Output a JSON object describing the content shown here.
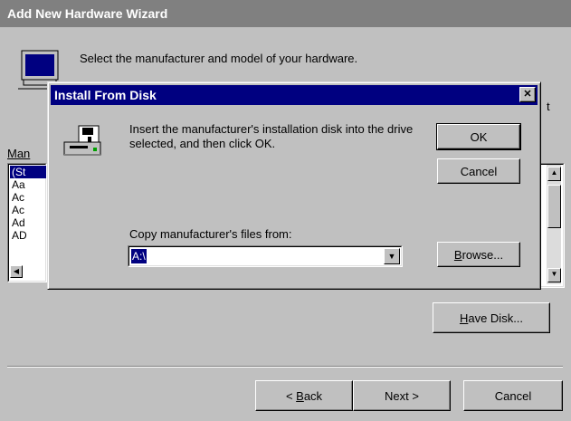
{
  "wizard": {
    "title": "Add New Hardware Wizard",
    "instruction": "Select the manufacturer and model of your hardware.",
    "right_fragment": "t",
    "manufacturers_label_prefix": "Man",
    "manufacturers": [
      "(St",
      "Aa",
      "Ac",
      "Ac",
      "Ad",
      "AD"
    ],
    "have_disk_prefix": "",
    "have_disk_hotkey": "H",
    "have_disk_rest": "ave Disk...",
    "back_prefix": "< ",
    "back_hotkey": "B",
    "back_rest": "ack",
    "next_label": "Next >",
    "cancel_label": "Cancel"
  },
  "dialog": {
    "title": "Install From Disk",
    "close_glyph": "✕",
    "message": "Insert the manufacturer's installation disk into the drive selected, and then click OK.",
    "ok_label": "OK",
    "cancel_label": "Cancel",
    "copy_label": "Copy manufacturer's files from:",
    "path_value": "A:\\",
    "browse_hotkey": "B",
    "browse_rest": "rowse..."
  }
}
